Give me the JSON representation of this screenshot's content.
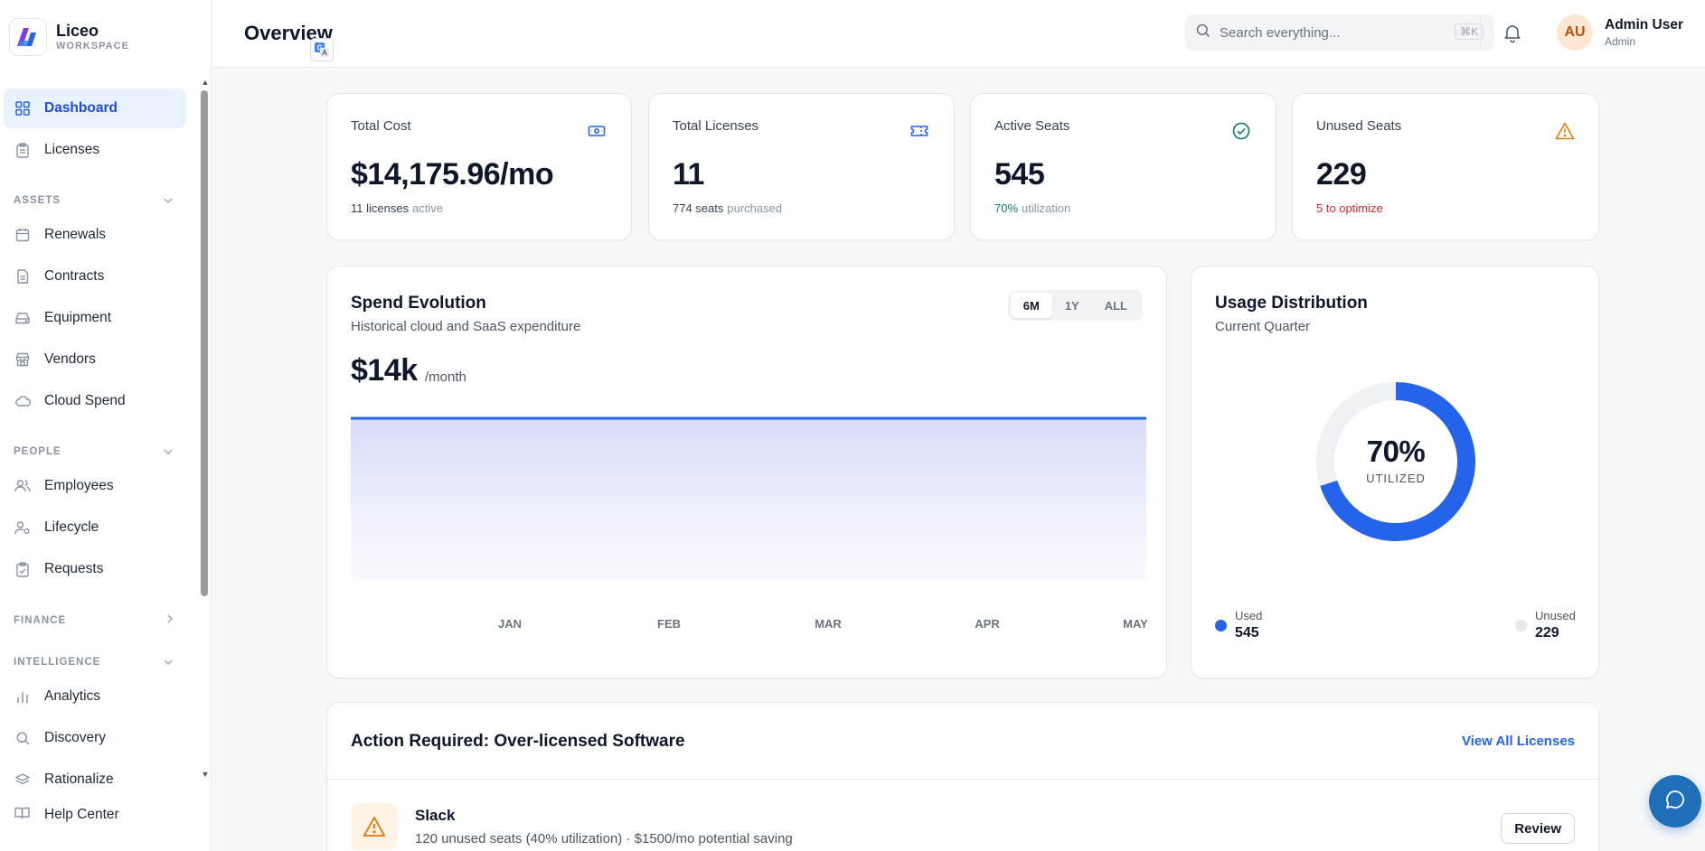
{
  "brand": {
    "name": "Liceo",
    "subtitle": "WORKSPACE"
  },
  "sidebar": {
    "items": [
      {
        "id": "dashboard",
        "label": "Dashboard",
        "icon": "grid-icon",
        "active": true
      },
      {
        "id": "licenses",
        "label": "Licenses",
        "icon": "clipboard-icon"
      }
    ],
    "sections": [
      {
        "label": "ASSETS",
        "state": "expanded",
        "items": [
          "Renewals",
          "Contracts",
          "Equipment",
          "Vendors",
          "Cloud Spend"
        ]
      },
      {
        "label": "PEOPLE",
        "state": "expanded",
        "items": [
          "Employees",
          "Lifecycle",
          "Requests"
        ]
      },
      {
        "label": "FINANCE",
        "state": "collapsed",
        "items": []
      },
      {
        "label": "INTELLIGENCE",
        "state": "expanded",
        "items": [
          "Analytics",
          "Discovery",
          "Rationalize"
        ]
      }
    ],
    "labels": {
      "renewals": "Renewals",
      "contracts": "Contracts",
      "equipment": "Equipment",
      "vendors": "Vendors",
      "cloud": "Cloud Spend",
      "employees": "Employees",
      "lifecycle": "Lifecycle",
      "requests": "Requests",
      "analytics": "Analytics",
      "discovery": "Discovery",
      "rationalize": "Rationalize"
    },
    "section_labels": {
      "assets": "ASSETS",
      "people": "PEOPLE",
      "finance": "FINANCE",
      "intelligence": "INTELLIGENCE"
    },
    "help": "Help Center"
  },
  "header": {
    "title": "Overview",
    "search_placeholder": "Search everything...",
    "search_shortcut": "⌘K",
    "user": {
      "initials": "AU",
      "name": "Admin User",
      "role": "Admin"
    }
  },
  "stats": {
    "total_cost": {
      "label": "Total Cost",
      "value": "$14,175.96/mo",
      "sub_strong": "11 licenses",
      "sub_muted": "active"
    },
    "total_licenses": {
      "label": "Total Licenses",
      "value": "11",
      "sub_strong": "774 seats",
      "sub_muted": "purchased"
    },
    "active_seats": {
      "label": "Active Seats",
      "value": "545",
      "sub_strong": "70%",
      "sub_muted": "utilization"
    },
    "unused_seats": {
      "label": "Unused Seats",
      "value": "229",
      "sub_alert": "5 to optimize"
    }
  },
  "colors": {
    "accent": "#2563eb",
    "success": "#0f766e",
    "warning": "#ea7a0c",
    "danger": "#dc2626",
    "unused": "#eef0f3"
  },
  "spend": {
    "title": "Spend Evolution",
    "subtitle": "Historical cloud and SaaS expenditure",
    "amount": "$14k",
    "unit": "/month",
    "ranges": [
      "6M",
      "1Y",
      "ALL"
    ],
    "selected_range": "6M"
  },
  "chart_data": {
    "type": "area",
    "categories": [
      "JAN",
      "FEB",
      "MAR",
      "APR",
      "MAY"
    ],
    "values": [
      14176,
      14176,
      14176,
      14176,
      14176
    ],
    "title": "Spend Evolution",
    "xlabel": "",
    "ylabel": "",
    "grid": false
  },
  "usage": {
    "title": "Usage Distribution",
    "subtitle": "Current Quarter",
    "percent": "70%",
    "caption": "UTILIZED",
    "used_fraction": 0.7,
    "used_label": "Used",
    "used_value": "545",
    "unused_label": "Unused",
    "unused_value": "229"
  },
  "actions": {
    "title": "Action Required: Over-licensed Software",
    "view_all": "View All Licenses",
    "rows": [
      {
        "name": "Slack",
        "desc": "120 unused seats (40% utilization) · $1500/mo potential saving",
        "button": "Review"
      }
    ]
  }
}
